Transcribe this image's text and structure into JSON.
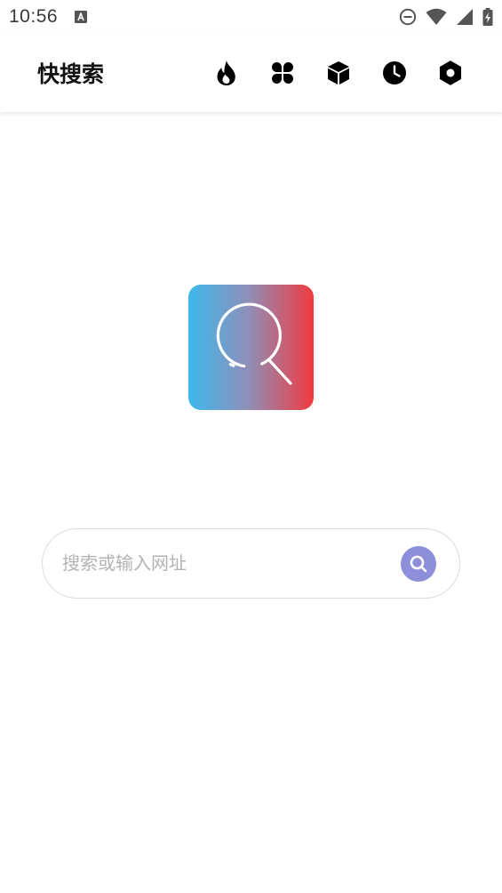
{
  "status_bar": {
    "time": "10:56",
    "icons": [
      "notification-a-icon",
      "do-not-disturb-icon",
      "wifi-icon",
      "cell-signal-icon",
      "battery-charging-icon"
    ]
  },
  "app_bar": {
    "title": "快搜索",
    "actions": [
      {
        "name": "hot-icon"
      },
      {
        "name": "apps-icon"
      },
      {
        "name": "box-icon"
      },
      {
        "name": "history-icon"
      },
      {
        "name": "settings-icon"
      }
    ]
  },
  "logo": {
    "name": "search-logo-icon",
    "colors": {
      "start": "#3eb8ec",
      "middle": "#8f8fb8",
      "end": "#f23a3e"
    }
  },
  "search": {
    "placeholder": "搜索或输入网址",
    "value": "",
    "button_color": "#8d8fdb"
  }
}
